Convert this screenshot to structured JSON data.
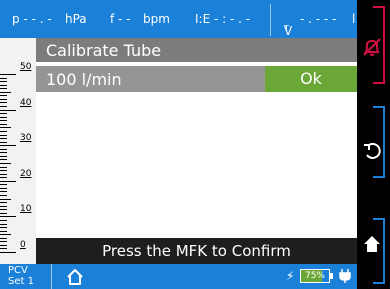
{
  "status_bar": {
    "pressure": "p - - . -",
    "pressure_unit": "hPa",
    "frequency": "f - -",
    "frequency_unit": "bpm",
    "ie_label": "I:E",
    "ie_value": "- : - . -",
    "volume_label": "V",
    "volume_sub": "T",
    "volume_value": " - . - - -",
    "volume_unit": "l"
  },
  "scale": {
    "labels": [
      "50",
      "40",
      "30",
      "20",
      "10",
      "0"
    ]
  },
  "dialog": {
    "title": "Calibrate Tube",
    "value": "100 l/min",
    "ok_label": "Ok"
  },
  "message": "Press the MFK to Confirm",
  "bottom_bar": {
    "mode_line1": "PCV",
    "mode_line2": "Set 1",
    "battery_percent": "75%",
    "battery_level": 0.75
  },
  "side_buttons": [
    {
      "name": "alarm-mute-button",
      "icon": "bell-off-icon"
    },
    {
      "name": "undo-button",
      "icon": "undo-icon"
    },
    {
      "name": "home-button",
      "icon": "home-icon"
    }
  ],
  "colors": {
    "primary_blue": "#1a80d8",
    "ok_green": "#6aa736",
    "alarm_red": "#d01040"
  }
}
